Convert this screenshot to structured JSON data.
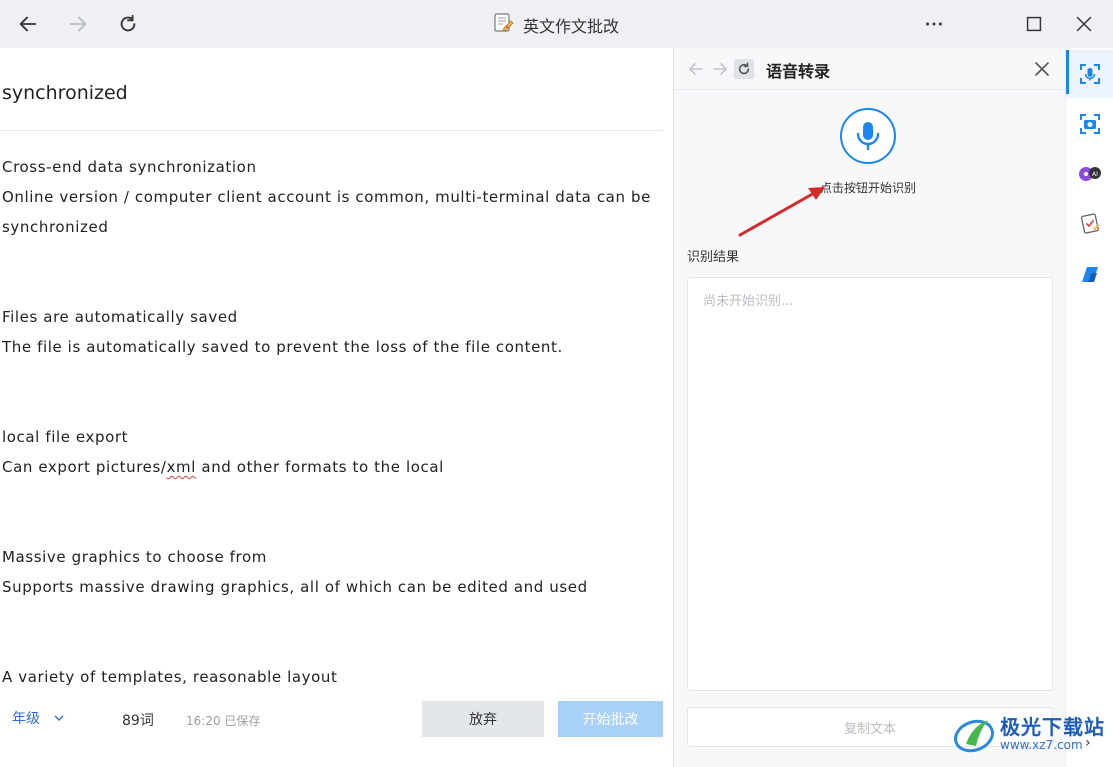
{
  "app": {
    "title": "英文作文批改",
    "icons": {
      "back": "arrow-left-icon",
      "forward": "arrow-right-icon",
      "refresh": "refresh-icon",
      "more": "more-icon",
      "maximize": "maximize-icon",
      "close": "close-icon"
    }
  },
  "editor": {
    "title": "synchronized",
    "lines": [
      "Cross-end data synchronization",
      "Online version / computer client account is common, multi-terminal data can be",
      "synchronized",
      "Files are automatically saved",
      "The file is automatically saved to prevent the loss of the file content.",
      "local file export",
      "Can export pictures/",
      "xml",
      " and other formats to the local",
      "Massive graphics to choose from",
      "Supports massive drawing graphics, all of which can be edited and used",
      "A variety of templates, reasonable layout"
    ]
  },
  "bottom_bar": {
    "grade": "年级",
    "word_count": "89词",
    "save_status": "16:20 已保存",
    "discard_label": "放弃",
    "start_review_label": "开始批改"
  },
  "panel": {
    "title": "语音转录",
    "mic_hint": "点击按钮开始识别",
    "result_label": "识别结果",
    "result_placeholder": "尚未开始识别...",
    "copy_label": "复制文本"
  },
  "watermark": {
    "cn": "极光下载站",
    "url": "www.xz7.com"
  },
  "colors": {
    "accent": "#1a86f0",
    "titlebar_bg": "#eef0f3",
    "arrow": "#d42a2a",
    "disabled_button": "#a9d0f8"
  }
}
